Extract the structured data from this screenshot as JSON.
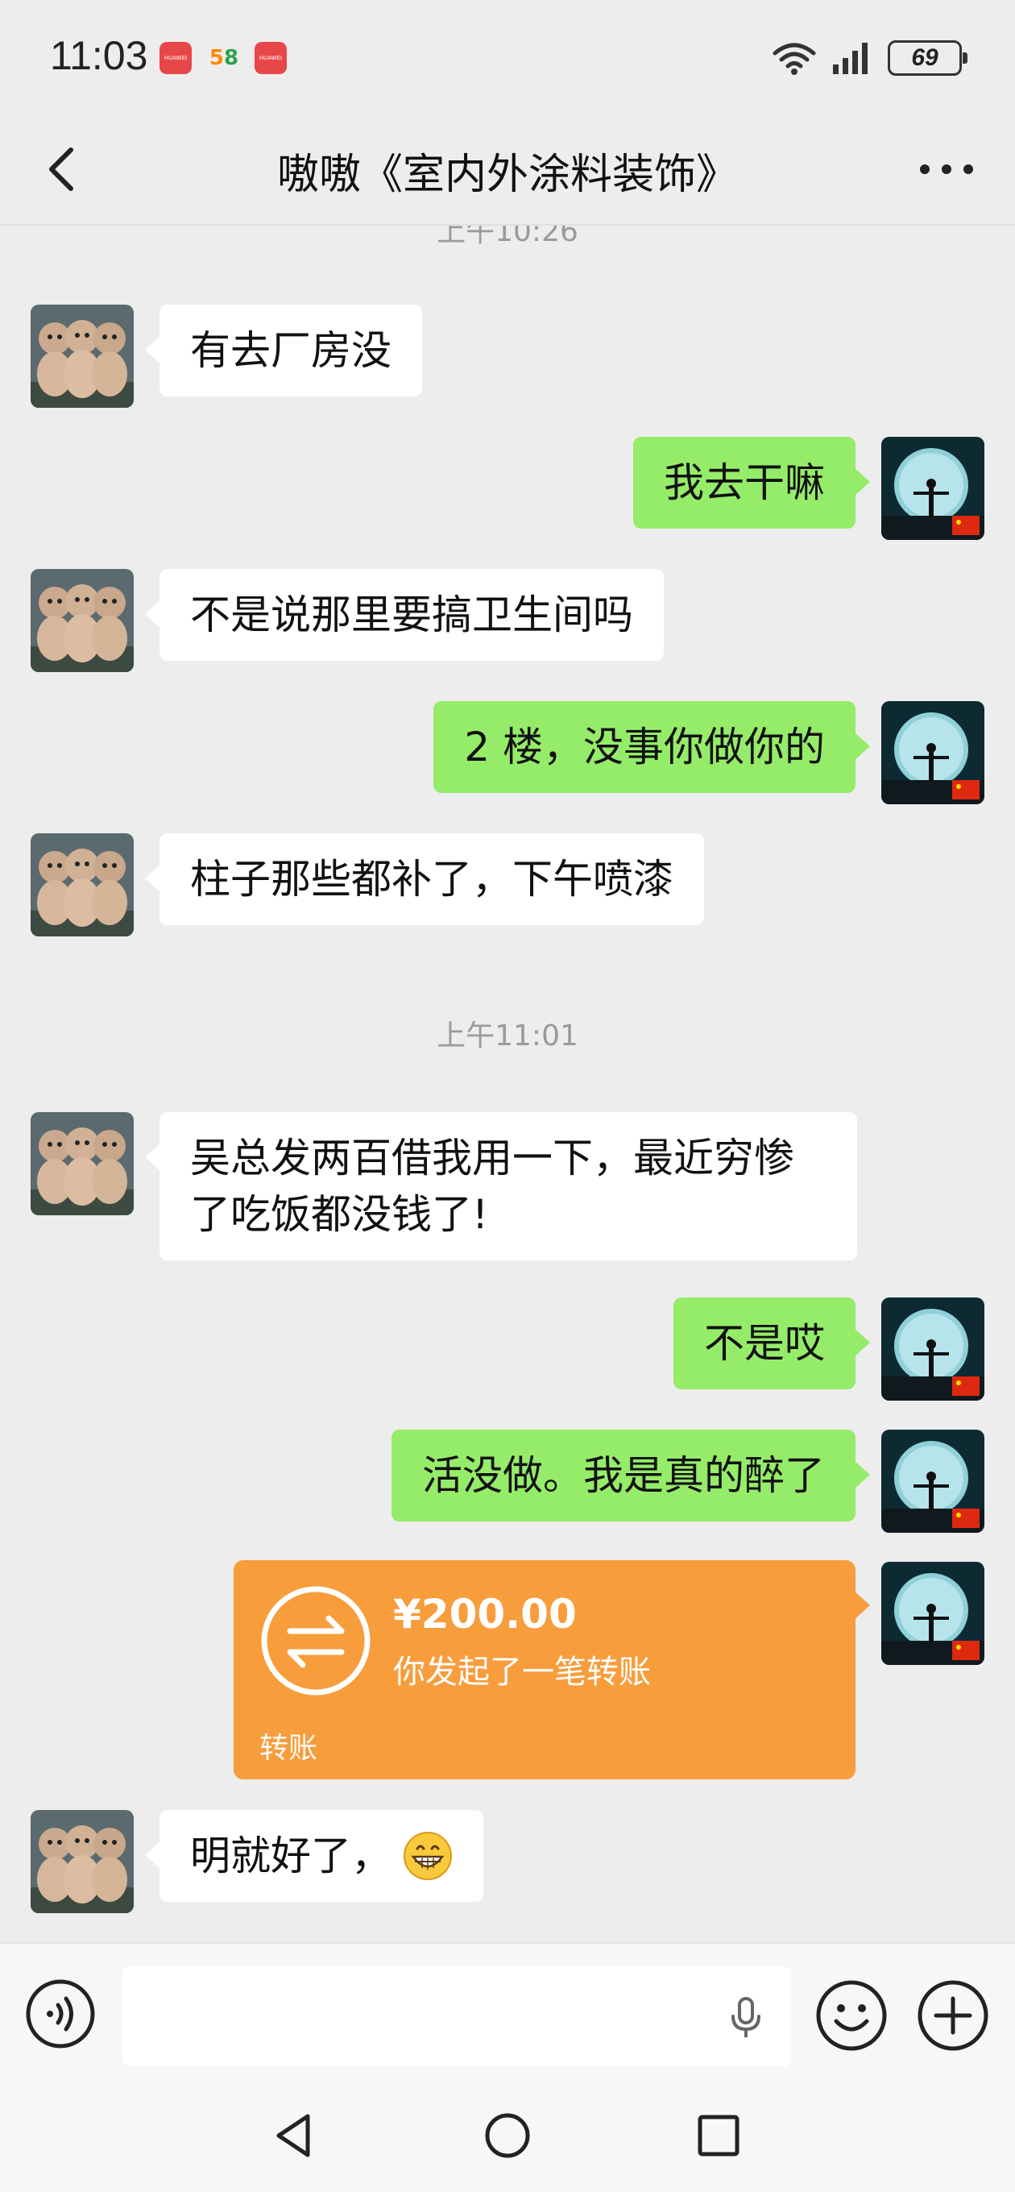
{
  "status_bar": {
    "time": "11:03",
    "badges": [
      "HUAWEI",
      "58",
      "HUAWEI"
    ],
    "battery": "69"
  },
  "header": {
    "title": "嗷嗷《室内外涂料装饰》"
  },
  "messages": [
    {
      "type": "time",
      "text": "上午10:26"
    },
    {
      "type": "text",
      "side": "left",
      "text": "有去厂房没"
    },
    {
      "type": "text",
      "side": "right",
      "text": "我去干嘛"
    },
    {
      "type": "text",
      "side": "left",
      "text": "不是说那里要搞卫生间吗"
    },
    {
      "type": "text",
      "side": "right",
      "text": "2 楼，没事你做你的"
    },
    {
      "type": "text",
      "side": "left",
      "text": "柱子那些都补了，下午喷漆"
    },
    {
      "type": "time",
      "text": "上午11:01"
    },
    {
      "type": "text",
      "side": "left",
      "text": "吴总发两百借我用一下，最近穷惨了吃饭都没钱了!"
    },
    {
      "type": "text",
      "side": "right",
      "text": "不是哎"
    },
    {
      "type": "text",
      "side": "right",
      "text": "活没做。我是真的醉了"
    },
    {
      "type": "transfer",
      "side": "right",
      "amount": "¥200.00",
      "desc": "你发起了一笔转账",
      "label": "转账"
    },
    {
      "type": "text",
      "side": "left",
      "text": "明就好了，",
      "emoji": "grinning-face"
    }
  ],
  "input_bar": {
    "placeholder": ""
  },
  "colors": {
    "background": "#ededed",
    "my_bubble": "#95ec69",
    "their_bubble": "#ffffff",
    "transfer_card": "#f79d3c"
  }
}
